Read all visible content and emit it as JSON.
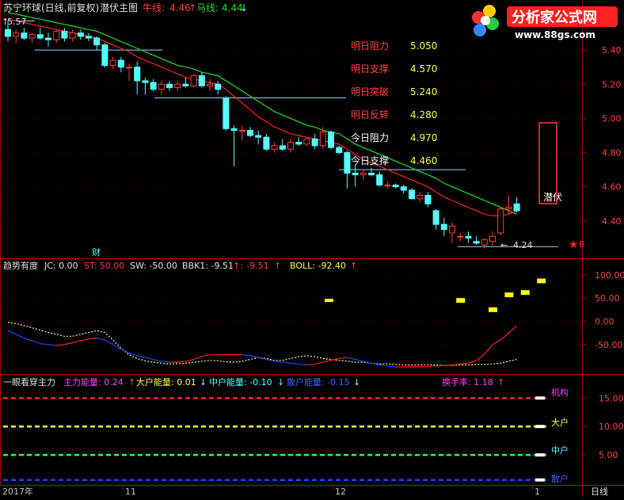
{
  "main_panel": {
    "title": "苏宁环球(日线,前复权)",
    "indicator": "潜伏主图",
    "ma1_label": "牛线:",
    "ma1_value": "4.46",
    "ma1_arrow": "↑",
    "ma2_label": "马线:",
    "ma2_value": "4.44",
    "ma2_arrow": "↓",
    "start_marker": "5.57",
    "low_marker": "4.24",
    "tag_qianfu": "潜伏",
    "tag_cai": "财",
    "tag_b": "B"
  },
  "levels": [
    {
      "label": "明日阻力",
      "value": "5.050",
      "color": "#ff4040"
    },
    {
      "label": "明日支撑",
      "value": "4.570",
      "color": "#ff4040"
    },
    {
      "label": "明日突破",
      "value": "5.240",
      "color": "#ff4040"
    },
    {
      "label": "明日反转",
      "value": "4.280",
      "color": "#ff4040"
    },
    {
      "label": "今日阻力",
      "value": "4.970",
      "color": "#ffffff"
    },
    {
      "label": "今日支撑",
      "value": "4.460",
      "color": "#ffffff"
    }
  ],
  "logo": {
    "name": "分析家公式网",
    "url": "www.88gs.com"
  },
  "mid_panel": {
    "title": "趋势有度",
    "jc": "JC: 0.00",
    "st": "ST: 50.00",
    "sw": "SW: -50.00",
    "bbk1": "BBK1: -9.51",
    "bbk1_arrow": "↑",
    "colon_val": ": -9.51",
    "colon_arrow": "↑",
    "boll": "BOLL: -92.40",
    "boll_arrow": "↑"
  },
  "bot_panel": {
    "title": "一眼看穿主力",
    "main_force": "主力能量: 0.24",
    "main_force_arrow": "↑",
    "large": "大户能量: 0.01",
    "large_arrow": "↓",
    "mid": "中户能量: -0.10",
    "mid_arrow": "↓",
    "retail": "散户能量: -0.15",
    "retail_arrow": "↓",
    "turnover": "换手率: 1.18",
    "turnover_arrow": "↑",
    "label_jigou": "机构",
    "label_dahu": "大户",
    "label_zhonghu": "中户",
    "label_sanhu": "散户"
  },
  "x_axis": {
    "labels": [
      "2017年",
      "11",
      "12",
      "1"
    ],
    "period": "日线"
  },
  "colors": {
    "up": "#ff3c3c",
    "down": "#54ffff",
    "ma_red": "#ff2020",
    "ma_green": "#20e020",
    "axis": "#a00000",
    "yellow": "#ffff00"
  },
  "chart_data": [
    {
      "type": "candlestick",
      "title": "潜伏主图",
      "ylim": [
        4.2,
        5.6
      ],
      "yticks": [
        4.4,
        4.6,
        4.8,
        5.0,
        5.2,
        5.4
      ],
      "candles": [
        {
          "o": 5.52,
          "h": 5.57,
          "l": 5.45,
          "c": 5.48
        },
        {
          "o": 5.48,
          "h": 5.52,
          "l": 5.44,
          "c": 5.5
        },
        {
          "o": 5.5,
          "h": 5.53,
          "l": 5.46,
          "c": 5.47
        },
        {
          "o": 5.47,
          "h": 5.5,
          "l": 5.44,
          "c": 5.49
        },
        {
          "o": 5.49,
          "h": 5.53,
          "l": 5.46,
          "c": 5.47
        },
        {
          "o": 5.47,
          "h": 5.5,
          "l": 5.42,
          "c": 5.46
        },
        {
          "o": 5.46,
          "h": 5.52,
          "l": 5.44,
          "c": 5.51
        },
        {
          "o": 5.51,
          "h": 5.53,
          "l": 5.45,
          "c": 5.47
        },
        {
          "o": 5.47,
          "h": 5.52,
          "l": 5.45,
          "c": 5.5
        },
        {
          "o": 5.5,
          "h": 5.52,
          "l": 5.46,
          "c": 5.48
        },
        {
          "o": 5.48,
          "h": 5.5,
          "l": 5.45,
          "c": 5.47
        },
        {
          "o": 5.47,
          "h": 5.48,
          "l": 5.4,
          "c": 5.43
        },
        {
          "o": 5.43,
          "h": 5.44,
          "l": 5.3,
          "c": 5.31
        },
        {
          "o": 5.31,
          "h": 5.36,
          "l": 5.29,
          "c": 5.34
        },
        {
          "o": 5.34,
          "h": 5.36,
          "l": 5.27,
          "c": 5.3
        },
        {
          "o": 5.3,
          "h": 5.32,
          "l": 5.22,
          "c": 5.3
        },
        {
          "o": 5.3,
          "h": 5.33,
          "l": 5.14,
          "c": 5.22
        },
        {
          "o": 5.22,
          "h": 5.24,
          "l": 5.14,
          "c": 5.21
        },
        {
          "o": 5.21,
          "h": 5.23,
          "l": 5.16,
          "c": 5.17
        },
        {
          "o": 5.17,
          "h": 5.22,
          "l": 5.14,
          "c": 5.2
        },
        {
          "o": 5.2,
          "h": 5.22,
          "l": 5.16,
          "c": 5.18
        },
        {
          "o": 5.18,
          "h": 5.22,
          "l": 5.16,
          "c": 5.2
        },
        {
          "o": 5.2,
          "h": 5.24,
          "l": 5.18,
          "c": 5.19
        },
        {
          "o": 5.19,
          "h": 5.26,
          "l": 5.18,
          "c": 5.25
        },
        {
          "o": 5.25,
          "h": 5.27,
          "l": 5.18,
          "c": 5.19
        },
        {
          "o": 5.19,
          "h": 5.23,
          "l": 5.16,
          "c": 5.2
        },
        {
          "o": 5.2,
          "h": 5.22,
          "l": 5.14,
          "c": 5.17
        },
        {
          "o": 5.12,
          "h": 5.13,
          "l": 4.93,
          "c": 4.94
        },
        {
          "o": 4.94,
          "h": 4.96,
          "l": 4.72,
          "c": 4.93
        },
        {
          "o": 4.93,
          "h": 4.96,
          "l": 4.87,
          "c": 4.93
        },
        {
          "o": 4.93,
          "h": 4.95,
          "l": 4.89,
          "c": 4.9
        },
        {
          "o": 4.9,
          "h": 4.93,
          "l": 4.85,
          "c": 4.89
        },
        {
          "o": 4.89,
          "h": 4.91,
          "l": 4.81,
          "c": 4.82
        },
        {
          "o": 4.82,
          "h": 4.86,
          "l": 4.8,
          "c": 4.84
        },
        {
          "o": 4.84,
          "h": 4.88,
          "l": 4.81,
          "c": 4.82
        },
        {
          "o": 4.82,
          "h": 4.88,
          "l": 4.8,
          "c": 4.86
        },
        {
          "o": 4.86,
          "h": 4.89,
          "l": 4.84,
          "c": 4.85
        },
        {
          "o": 4.85,
          "h": 4.89,
          "l": 4.84,
          "c": 4.88
        },
        {
          "o": 4.88,
          "h": 4.91,
          "l": 4.82,
          "c": 4.84
        },
        {
          "o": 4.84,
          "h": 4.95,
          "l": 4.82,
          "c": 4.92
        },
        {
          "o": 4.92,
          "h": 4.93,
          "l": 4.82,
          "c": 4.83
        },
        {
          "o": 4.83,
          "h": 4.84,
          "l": 4.79,
          "c": 4.8
        },
        {
          "o": 4.8,
          "h": 4.81,
          "l": 4.59,
          "c": 4.68
        },
        {
          "o": 4.68,
          "h": 4.73,
          "l": 4.6,
          "c": 4.67
        },
        {
          "o": 4.67,
          "h": 4.7,
          "l": 4.64,
          "c": 4.68
        },
        {
          "o": 4.68,
          "h": 4.71,
          "l": 4.66,
          "c": 4.67
        },
        {
          "o": 4.67,
          "h": 4.69,
          "l": 4.6,
          "c": 4.61
        },
        {
          "o": 4.61,
          "h": 4.63,
          "l": 4.59,
          "c": 4.61
        },
        {
          "o": 4.61,
          "h": 4.62,
          "l": 4.59,
          "c": 4.6
        },
        {
          "o": 4.6,
          "h": 4.61,
          "l": 4.56,
          "c": 4.58
        },
        {
          "o": 4.58,
          "h": 4.59,
          "l": 4.53,
          "c": 4.53
        },
        {
          "o": 4.53,
          "h": 4.57,
          "l": 4.51,
          "c": 4.55
        },
        {
          "o": 4.55,
          "h": 4.57,
          "l": 4.48,
          "c": 4.5
        },
        {
          "o": 4.46,
          "h": 4.47,
          "l": 4.35,
          "c": 4.38
        },
        {
          "o": 4.38,
          "h": 4.42,
          "l": 4.31,
          "c": 4.35
        },
        {
          "o": 4.33,
          "h": 4.39,
          "l": 4.27,
          "c": 4.37
        },
        {
          "o": 4.31,
          "h": 4.33,
          "l": 4.28,
          "c": 4.31
        },
        {
          "o": 4.31,
          "h": 4.34,
          "l": 4.27,
          "c": 4.3
        },
        {
          "o": 4.28,
          "h": 4.31,
          "l": 4.26,
          "c": 4.27
        },
        {
          "o": 4.26,
          "h": 4.3,
          "l": 4.24,
          "c": 4.29
        },
        {
          "o": 4.28,
          "h": 4.34,
          "l": 4.25,
          "c": 4.31
        },
        {
          "o": 4.33,
          "h": 4.48,
          "l": 4.32,
          "c": 4.47
        },
        {
          "o": 4.47,
          "h": 4.55,
          "l": 4.44,
          "c": 4.48
        },
        {
          "o": 4.5,
          "h": 4.54,
          "l": 4.45,
          "c": 4.46
        }
      ],
      "ma_red": [
        5.58,
        5.57,
        5.56,
        5.55,
        5.54,
        5.53,
        5.52,
        5.51,
        5.5,
        5.49,
        5.48,
        5.47,
        5.45,
        5.43,
        5.41,
        5.39,
        5.36,
        5.34,
        5.32,
        5.3,
        5.28,
        5.26,
        5.24,
        5.23,
        5.22,
        5.21,
        5.2,
        5.17,
        5.13,
        5.09,
        5.05,
        5.01,
        4.98,
        4.95,
        4.93,
        4.91,
        4.9,
        4.89,
        4.88,
        4.87,
        4.86,
        4.85,
        4.82,
        4.79,
        4.76,
        4.74,
        4.72,
        4.7,
        4.68,
        4.66,
        4.64,
        4.62,
        4.6,
        4.57,
        4.54,
        4.52,
        4.5,
        4.48,
        4.46,
        4.44,
        4.43,
        4.43,
        4.44,
        4.46
      ],
      "ma_green": [
        5.62,
        5.61,
        5.6,
        5.59,
        5.58,
        5.57,
        5.56,
        5.55,
        5.54,
        5.53,
        5.52,
        5.51,
        5.49,
        5.47,
        5.45,
        5.43,
        5.41,
        5.39,
        5.37,
        5.35,
        5.33,
        5.31,
        5.3,
        5.29,
        5.27,
        5.26,
        5.25,
        5.22,
        5.19,
        5.16,
        5.13,
        5.1,
        5.07,
        5.04,
        5.02,
        5.0,
        4.98,
        4.96,
        4.95,
        4.93,
        4.92,
        4.91,
        4.88,
        4.85,
        4.83,
        4.81,
        4.79,
        4.77,
        4.75,
        4.73,
        4.71,
        4.69,
        4.67,
        4.65,
        4.62,
        4.6,
        4.58,
        4.56,
        4.54,
        4.52,
        4.5,
        4.48,
        4.46,
        4.44
      ],
      "hlines": [
        5.4,
        5.12,
        4.7,
        4.25
      ]
    },
    {
      "type": "line",
      "title": "趋势有度",
      "ylim": [
        -110,
        110
      ],
      "yticks": [
        100.0,
        50.0,
        0.0,
        -50.0
      ],
      "bbk1": [
        -20,
        -28,
        -36,
        -42,
        -48,
        -50,
        -52,
        -50,
        -46,
        -42,
        -38,
        -36,
        -40,
        -50,
        -60,
        -68,
        -74,
        -78,
        -82,
        -86,
        -88,
        -88,
        -86,
        -82,
        -76,
        -72,
        -72,
        -72,
        -72,
        -72,
        -74,
        -78,
        -82,
        -86,
        -88,
        -90,
        -92,
        -94,
        -92,
        -88,
        -84,
        -80,
        -78,
        -82,
        -86,
        -90,
        -94,
        -96,
        -98,
        -98,
        -98,
        -98,
        -97,
        -96,
        -95,
        -94,
        -92,
        -90,
        -85,
        -70,
        -50,
        -40,
        -25,
        -10
      ],
      "boll": [
        -2,
        -5,
        -9,
        -14,
        -19,
        -24,
        -28,
        -32,
        -32,
        -28,
        -24,
        -20,
        -24,
        -40,
        -58,
        -72,
        -80,
        -85,
        -88,
        -90,
        -92,
        -91,
        -90,
        -88,
        -86,
        -84,
        -85,
        -87,
        -88,
        -86,
        -82,
        -78,
        -80,
        -84,
        -84,
        -80,
        -76,
        -74,
        -76,
        -80,
        -82,
        -84,
        -86,
        -88,
        -88,
        -90,
        -92,
        -92,
        -93,
        -94,
        -94,
        -94,
        -93,
        -94,
        -95,
        -95,
        -94,
        -94,
        -93,
        -93,
        -92,
        -90,
        -86,
        -82
      ],
      "yellow_bars": [
        [
          56,
          45
        ],
        [
          60,
          25
        ],
        [
          62,
          57
        ],
        [
          64,
          62
        ],
        [
          66,
          87
        ]
      ]
    },
    {
      "type": "line",
      "title": "一眼看穿主力",
      "ylim": [
        0,
        17
      ],
      "yticks": [
        15.0,
        10.0,
        5.0
      ],
      "series": [
        {
          "name": "主力能量",
          "level": 15.0,
          "color": "#ff2040"
        },
        {
          "name": "大户能量",
          "level": 10.0,
          "color": "#ffff40"
        },
        {
          "name": "中户能量",
          "level": 5.0,
          "color": "#20ff60"
        },
        {
          "name": "散户能量",
          "level": 0.6,
          "color": "#2040ff"
        }
      ]
    }
  ]
}
